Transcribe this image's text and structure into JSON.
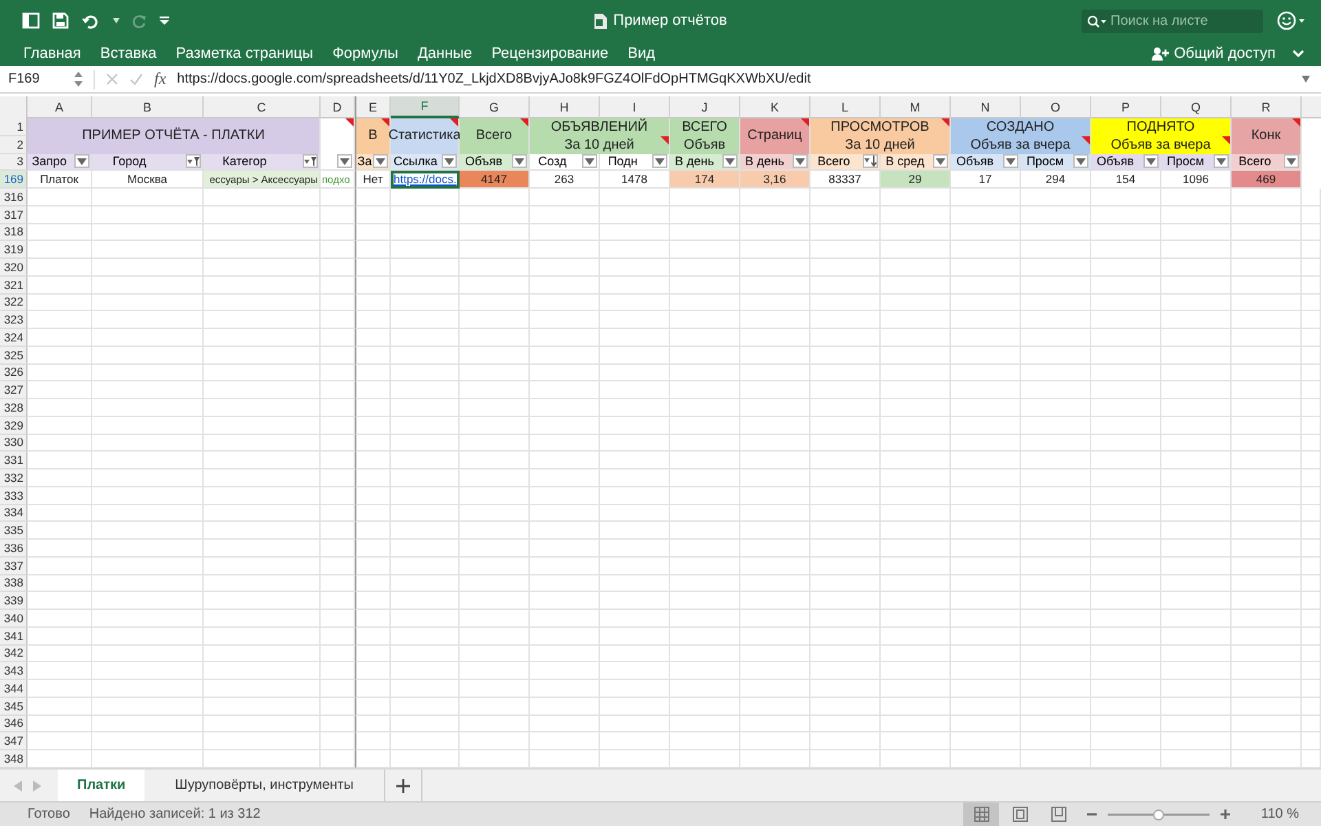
{
  "titlebar": {
    "title": "Пример отчётов",
    "search": {
      "placeholder": "Поиск на листе"
    }
  },
  "ribbon": {
    "tabs": [
      {
        "label": "Главная"
      },
      {
        "label": "Вставка"
      },
      {
        "label": "Разметка страницы"
      },
      {
        "label": "Формулы"
      },
      {
        "label": "Данные"
      },
      {
        "label": "Рецензирование"
      },
      {
        "label": "Вид"
      }
    ],
    "share": "Общий доступ"
  },
  "formula_bar": {
    "cell": "F169",
    "fx": "fx",
    "formula": "https://docs.google.com/spreadsheets/d/11Y0Z_LkjdXD8BvjyAJo8k9FGZ4OlFdOpHTMGqKXWbXU/edit"
  },
  "sheet": {
    "columns": [
      {
        "letter": "A",
        "selected": false
      },
      {
        "letter": "B",
        "selected": false
      },
      {
        "letter": "C",
        "selected": false
      },
      {
        "letter": "D",
        "selected": false
      },
      {
        "letter": "E",
        "selected": false
      },
      {
        "letter": "F",
        "selected": true
      },
      {
        "letter": "G",
        "selected": false
      },
      {
        "letter": "H",
        "selected": false
      },
      {
        "letter": "I",
        "selected": false
      },
      {
        "letter": "J",
        "selected": false
      },
      {
        "letter": "K",
        "selected": false
      },
      {
        "letter": "L",
        "selected": false
      },
      {
        "letter": "M",
        "selected": false
      },
      {
        "letter": "N",
        "selected": false
      },
      {
        "letter": "O",
        "selected": false
      },
      {
        "letter": "P",
        "selected": false
      },
      {
        "letter": "Q",
        "selected": false
      },
      {
        "letter": "R",
        "selected": false
      }
    ],
    "bands": [
      {
        "top": {
          "text": "ПРИМЕР ОТЧЁТА - ПЛАТКИ",
          "comment": false
        },
        "color": "#d5cbe6",
        "headers": [
          {
            "label": "Запро",
            "color": "#e4dcef",
            "kind": "plain"
          },
          {
            "label": "Город",
            "color": "#e4dcef",
            "kind": "filtered"
          },
          {
            "label": "Категор",
            "color": "#e4dcef",
            "kind": "filtered"
          }
        ]
      },
      {
        "top": {
          "comment": true
        },
        "headers": [
          {
            "kind": "plain"
          }
        ]
      },
      {
        "top": {
          "text": "В",
          "comment": true
        },
        "color": "#f9cb9c",
        "headers": [
          {
            "label": "За",
            "color": "#fbe0c4",
            "kind": "plain"
          }
        ]
      },
      {
        "top": {
          "text": "Статистика",
          "comment": true
        },
        "color": "#c6d9f0",
        "headers": [
          {
            "label": "Ссылка",
            "color": "#dbe7f6",
            "kind": "plain"
          }
        ]
      },
      {
        "top": {
          "text": "Всего",
          "comment": true
        },
        "color": "#b6dcae",
        "headers": [
          {
            "label": "Объяв",
            "color": "#d5ecd0",
            "kind": "plain"
          }
        ]
      },
      {
        "top": {
          "text": "ОБЪЯВЛЕНИЙ",
          "comment": false
        },
        "bottom": {
          "text": "За 10 дней",
          "comment": true
        },
        "color": "#b6dcae",
        "headers": [
          {
            "label": "Созд",
            "color": "#ffffff",
            "kind": "plain"
          },
          {
            "label": "Подн",
            "color": "#ffffff",
            "kind": "plain"
          }
        ]
      },
      {
        "top": {
          "text": "ВСЕГО",
          "comment": false
        },
        "bottom": {
          "text": "Объяв",
          "comment": false
        },
        "color": "#b6dcae",
        "headers": [
          {
            "label": "В день",
            "color": "#d5ecd0",
            "kind": "plain"
          }
        ]
      },
      {
        "top": {
          "text": "Страниц",
          "comment": true
        },
        "color": "#e8a1a1",
        "headers": [
          {
            "label": "В день",
            "color": "#f3d0d0",
            "kind": "plain"
          }
        ]
      },
      {
        "top": {
          "text": "ПРОСМОТРОВ",
          "comment": true
        },
        "bottom": {
          "text": "За 10 дней",
          "comment": false
        },
        "color": "#f9c9a0",
        "headers": [
          {
            "label": "Всего",
            "color": "#fde4cf",
            "kind": "sorted"
          },
          {
            "label": "В сред",
            "color": "#fde4cf",
            "kind": "plain"
          }
        ]
      },
      {
        "top": {
          "text": "СОЗДАНО",
          "comment": false
        },
        "bottom": {
          "text": "Объяв за вчера",
          "comment": true
        },
        "color": "#a9c8ec",
        "headers": [
          {
            "label": "Объяв",
            "color": "#d6e4f5",
            "kind": "plain"
          },
          {
            "label": "Просм",
            "color": "#d6e4f5",
            "kind": "plain"
          }
        ]
      },
      {
        "top": {
          "text": "ПОДНЯТО",
          "comment": false
        },
        "bottom": {
          "text": "Объяв за вчера",
          "comment": true
        },
        "color": "#ffff00",
        "headers": [
          {
            "label": "Объяв",
            "color": "#e1d9ee",
            "kind": "plain"
          },
          {
            "label": "Просм",
            "color": "#e1d9ee",
            "kind": "plain"
          }
        ]
      },
      {
        "top": {
          "text": "Конк",
          "comment": true
        },
        "color": "#e6a4a4",
        "headers": [
          {
            "label": "Всего",
            "color": "#f2cece",
            "kind": "plain"
          }
        ]
      }
    ],
    "row_numbers": [
      {
        "label": "1",
        "filtered": false
      },
      {
        "label": "2",
        "filtered": false
      },
      {
        "label": "3",
        "filtered": false
      },
      {
        "label": "169",
        "filtered": true
      },
      {
        "label": "316",
        "filtered": false
      },
      {
        "label": "317",
        "filtered": false
      },
      {
        "label": "318",
        "filtered": false
      },
      {
        "label": "319",
        "filtered": false
      },
      {
        "label": "320",
        "filtered": false
      },
      {
        "label": "321",
        "filtered": false
      },
      {
        "label": "322",
        "filtered": false
      },
      {
        "label": "323",
        "filtered": false
      },
      {
        "label": "324",
        "filtered": false
      },
      {
        "label": "325",
        "filtered": false
      },
      {
        "label": "326",
        "filtered": false
      },
      {
        "label": "327",
        "filtered": false
      },
      {
        "label": "328",
        "filtered": false
      },
      {
        "label": "329",
        "filtered": false
      },
      {
        "label": "330",
        "filtered": false
      },
      {
        "label": "331",
        "filtered": false
      },
      {
        "label": "332",
        "filtered": false
      },
      {
        "label": "333",
        "filtered": false
      },
      {
        "label": "334",
        "filtered": false
      },
      {
        "label": "335",
        "filtered": false
      },
      {
        "label": "336",
        "filtered": false
      },
      {
        "label": "337",
        "filtered": false
      },
      {
        "label": "338",
        "filtered": false
      },
      {
        "label": "339",
        "filtered": false
      },
      {
        "label": "340",
        "filtered": false
      },
      {
        "label": "341",
        "filtered": false
      },
      {
        "label": "342",
        "filtered": false
      },
      {
        "label": "343",
        "filtered": false
      },
      {
        "label": "344",
        "filtered": false
      },
      {
        "label": "345",
        "filtered": false
      },
      {
        "label": "346",
        "filtered": false
      },
      {
        "label": "347",
        "filtered": false
      },
      {
        "label": "348",
        "filtered": false
      }
    ],
    "rows": [
      {
        "cells": [
          {
            "text": "Платок",
            "kind": "plain",
            "selected": false
          },
          {
            "text": "Москва",
            "kind": "plain",
            "selected": false
          },
          {
            "text": "ессуары > Аксессуары",
            "kind": "clipped",
            "color": "#e2f0d9",
            "selected": false
          },
          {
            "text": "подхо",
            "kind": "note",
            "selected": false
          },
          {
            "text": "Нет",
            "kind": "plain",
            "selected": false
          },
          {
            "text": "https://docs.",
            "kind": "link",
            "selected": true
          },
          {
            "text": "4147",
            "kind": "plain",
            "color": "#e9875a",
            "selected": false
          },
          {
            "text": "263",
            "kind": "plain",
            "selected": false
          },
          {
            "text": "1478",
            "kind": "plain",
            "selected": false
          },
          {
            "text": "174",
            "kind": "plain",
            "color": "#f8cbad",
            "selected": false
          },
          {
            "text": "3,16",
            "kind": "plain",
            "color": "#f8cbad",
            "selected": false
          },
          {
            "text": "83337",
            "kind": "plain",
            "selected": false
          },
          {
            "text": "29",
            "kind": "plain",
            "color": "#c6e2bf",
            "selected": false
          },
          {
            "text": "17",
            "kind": "plain",
            "selected": false
          },
          {
            "text": "294",
            "kind": "plain",
            "selected": false
          },
          {
            "text": "154",
            "kind": "plain",
            "selected": false
          },
          {
            "text": "1096",
            "kind": "plain",
            "selected": false
          },
          {
            "text": "469",
            "kind": "plain",
            "color": "#e58a8a",
            "selected": false
          }
        ]
      }
    ]
  },
  "sheet_tabs": [
    {
      "label": "Платки",
      "selected": true
    },
    {
      "label": "Шуруповёрты, инструменты",
      "selected": false
    }
  ],
  "status_bar": {
    "status": "Готово",
    "records": "Найдено записей: 1 из 312",
    "views": [
      {
        "kind": "normal",
        "selected": true
      },
      {
        "kind": "page_layout",
        "selected": false
      },
      {
        "kind": "page_break",
        "selected": false
      }
    ],
    "zoom": {
      "level": 0.5,
      "reading": "110 %"
    }
  }
}
